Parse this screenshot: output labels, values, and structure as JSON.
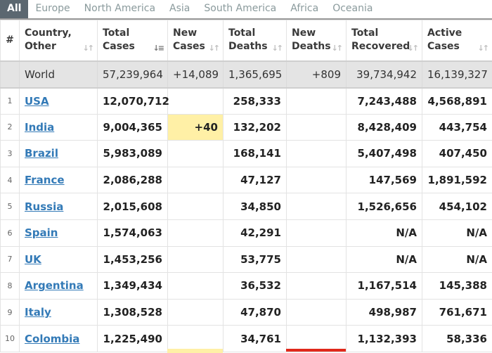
{
  "tabs": [
    {
      "label": "All",
      "active": true
    },
    {
      "label": "Europe",
      "active": false
    },
    {
      "label": "North America",
      "active": false
    },
    {
      "label": "Asia",
      "active": false
    },
    {
      "label": "South America",
      "active": false
    },
    {
      "label": "Africa",
      "active": false
    },
    {
      "label": "Oceania",
      "active": false
    }
  ],
  "headers": {
    "num": "#",
    "country": [
      "Country,",
      "Other"
    ],
    "total_cases": [
      "Total",
      "Cases"
    ],
    "new_cases": [
      "New",
      "Cases"
    ],
    "total_deaths": [
      "Total",
      "Deaths"
    ],
    "new_deaths": [
      "New",
      "Deaths"
    ],
    "total_recovered": [
      "Total",
      "Recovered"
    ],
    "active_cases": [
      "Active",
      "Cases"
    ]
  },
  "world": {
    "label": "World",
    "total_cases": "57,239,964",
    "new_cases": "+14,089",
    "total_deaths": "1,365,695",
    "new_deaths": "+809",
    "total_recovered": "39,734,942",
    "active_cases": "16,139,327"
  },
  "rows": [
    {
      "num": "1",
      "country": "USA",
      "total_cases": "12,070,712",
      "new_cases": "",
      "total_deaths": "258,333",
      "new_deaths": "",
      "total_recovered": "7,243,488",
      "active_cases": "4,568,891"
    },
    {
      "num": "2",
      "country": "India",
      "total_cases": "9,004,365",
      "new_cases": "+40",
      "total_deaths": "132,202",
      "new_deaths": "",
      "total_recovered": "8,428,409",
      "active_cases": "443,754"
    },
    {
      "num": "3",
      "country": "Brazil",
      "total_cases": "5,983,089",
      "new_cases": "",
      "total_deaths": "168,141",
      "new_deaths": "",
      "total_recovered": "5,407,498",
      "active_cases": "407,450"
    },
    {
      "num": "4",
      "country": "France",
      "total_cases": "2,086,288",
      "new_cases": "",
      "total_deaths": "47,127",
      "new_deaths": "",
      "total_recovered": "147,569",
      "active_cases": "1,891,592"
    },
    {
      "num": "5",
      "country": "Russia",
      "total_cases": "2,015,608",
      "new_cases": "",
      "total_deaths": "34,850",
      "new_deaths": "",
      "total_recovered": "1,526,656",
      "active_cases": "454,102"
    },
    {
      "num": "6",
      "country": "Spain",
      "total_cases": "1,574,063",
      "new_cases": "",
      "total_deaths": "42,291",
      "new_deaths": "",
      "total_recovered": "N/A",
      "active_cases": "N/A"
    },
    {
      "num": "7",
      "country": "UK",
      "total_cases": "1,453,256",
      "new_cases": "",
      "total_deaths": "53,775",
      "new_deaths": "",
      "total_recovered": "N/A",
      "active_cases": "N/A"
    },
    {
      "num": "8",
      "country": "Argentina",
      "total_cases": "1,349,434",
      "new_cases": "",
      "total_deaths": "36,532",
      "new_deaths": "",
      "total_recovered": "1,167,514",
      "active_cases": "145,388"
    },
    {
      "num": "9",
      "country": "Italy",
      "total_cases": "1,308,528",
      "new_cases": "",
      "total_deaths": "47,870",
      "new_deaths": "",
      "total_recovered": "498,987",
      "active_cases": "761,671"
    },
    {
      "num": "10",
      "country": "Colombia",
      "total_cases": "1,225,490",
      "new_cases": "",
      "total_deaths": "34,761",
      "new_deaths": "",
      "total_recovered": "1,132,393",
      "active_cases": "58,336"
    }
  ],
  "colors": {
    "active_tab_bg": "#5b6770",
    "link": "#337ab7",
    "new_cases_highlight": "#fff0a6",
    "new_deaths_highlight": "#e0291b",
    "world_row_bg": "#e4e4e4"
  },
  "sort": {
    "active_column": "total_cases",
    "direction": "descending"
  }
}
